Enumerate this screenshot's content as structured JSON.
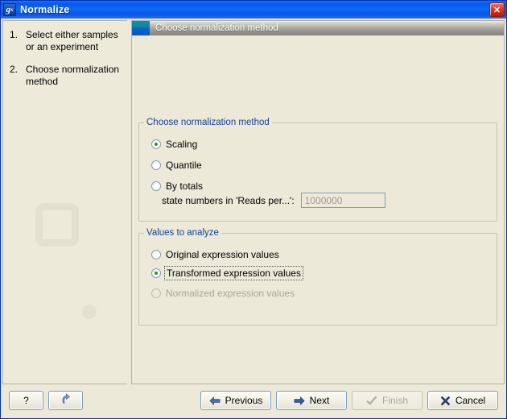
{
  "window": {
    "title": "Normalize",
    "icon": "application-gx-icon",
    "close_label": "✕",
    "frame_color": "#0b46e0",
    "titlebar_gradient_from": "#1a7bf0",
    "titlebar_gradient_to": "#0a55e8"
  },
  "sidebar": {
    "background": "#edeada",
    "steps": [
      {
        "number": "1.",
        "label": "Select either samples or an experiment"
      },
      {
        "number": "2.",
        "label": "Choose normalization method"
      }
    ]
  },
  "main": {
    "header": {
      "title": "Choose normalization method",
      "icon": "step-indicator-icon",
      "icon_color_from": "#0e8fa8",
      "icon_color_to": "#0a55c0"
    },
    "groups": [
      {
        "id": "method",
        "title": "Choose normalization method",
        "title_color": "#16409b",
        "options": [
          {
            "label": "Scaling",
            "checked": true,
            "disabled": false,
            "focused": false
          },
          {
            "label": "Quantile",
            "checked": false,
            "disabled": false,
            "focused": false
          },
          {
            "label": "By totals",
            "checked": false,
            "disabled": false,
            "focused": false
          }
        ],
        "field": {
          "label": "state numbers in 'Reads per...':",
          "value": "1000000",
          "placeholder": "1000000",
          "disabled": true
        }
      },
      {
        "id": "values",
        "title": "Values to analyze",
        "title_color": "#16409b",
        "options": [
          {
            "label": "Original expression values",
            "checked": false,
            "disabled": false,
            "focused": false
          },
          {
            "label": "Transformed expression values",
            "checked": true,
            "disabled": false,
            "focused": true
          },
          {
            "label": "Normalized expression values",
            "checked": false,
            "disabled": true,
            "focused": false
          }
        ]
      }
    ]
  },
  "buttons": {
    "help": {
      "label": "?",
      "name": "help-button",
      "disabled": false
    },
    "reset": {
      "label": "",
      "name": "reset-button",
      "icon": "undo-arrow-icon",
      "disabled": false
    },
    "previous": {
      "label": "Previous",
      "icon": "arrow-left-icon",
      "disabled": false
    },
    "next": {
      "label": "Next",
      "icon": "arrow-right-icon",
      "disabled": false
    },
    "finish": {
      "label": "Finish",
      "icon": "checkmark-icon",
      "disabled": true
    },
    "cancel": {
      "label": "Cancel",
      "icon": "x-mark-icon",
      "disabled": false
    }
  },
  "colors": {
    "panel_bg": "#ece9d8",
    "group_border": "#c7c4b4",
    "accent_blue": "#16409b",
    "radio_selected": "#1a9e1a",
    "disabled_text": "#a9a69a"
  }
}
